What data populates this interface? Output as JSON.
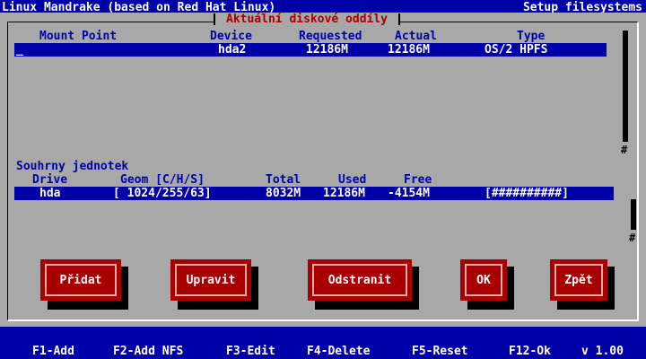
{
  "titlebar": {
    "left": "Linux Mandrake (based on Red Hat Linux)",
    "right": "Setup filesystems"
  },
  "dialog": {
    "title": "Aktuální diskové oddíly"
  },
  "partitions": {
    "headers": {
      "mount": "Mount Point",
      "device": "Device",
      "requested": "Requested",
      "actual": "Actual",
      "type": "Type"
    },
    "rows": [
      {
        "mount": "_",
        "device": "hda2",
        "requested": "12186M",
        "actual": "12186M",
        "type": "OS/2 HPFS"
      }
    ]
  },
  "summary": {
    "label": "Souhrny jednotek",
    "headers": {
      "drive": "Drive",
      "geom": "Geom [C/H/S]",
      "total": "Total",
      "used": "Used",
      "free": "Free"
    },
    "rows": [
      {
        "drive": "hda",
        "geom": "[ 1024/255/63]",
        "total": "8032M",
        "used": "12186M",
        "free": "-4154M",
        "bar": "[##########]"
      }
    ]
  },
  "buttons": {
    "add": "Přidat",
    "edit": "Upravit",
    "delete": "Odstranit",
    "ok": "OK",
    "back": "Zpět"
  },
  "fkeys": {
    "f1": "F1-Add",
    "f2": "F2-Add NFS",
    "f3": "F3-Edit",
    "f4": "F4-Delete",
    "f5": "F5-Reset",
    "f12": "F12-Ok",
    "version": "v 1.00"
  },
  "colors": {
    "screen": "#0000a8",
    "dialog": "#a8a8a8",
    "button": "#a80000",
    "title_text": "#a80000",
    "highlight": "#0000a8"
  }
}
